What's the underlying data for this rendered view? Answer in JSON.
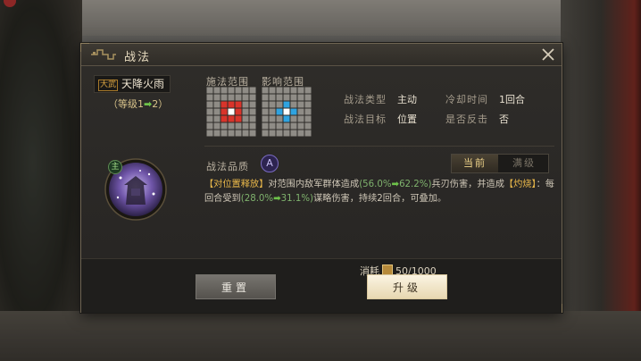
{
  "dialog": {
    "title": "战法",
    "close_label": "×"
  },
  "skill": {
    "badge": "大武",
    "name": "天降火雨",
    "level_prefix": "（等级1",
    "level_arrow": "➡",
    "level_suffix": "2）",
    "main_badge": "主"
  },
  "ranges": {
    "cast_label": "施法范围",
    "effect_label": "影响范围"
  },
  "info": {
    "type_label": "战法类型",
    "type_value": "主动",
    "cooldown_label": "冷却时间",
    "cooldown_value": "1回合",
    "target_label": "战法目标",
    "target_value": "位置",
    "counter_label": "是否反击",
    "counter_value": "否"
  },
  "quality": {
    "label": "战法品质",
    "grade": "A"
  },
  "toggle": {
    "current": "当前",
    "max": "满级"
  },
  "description": {
    "kw1": "【对位置释放】",
    "t1": "对范围内敌军群体造成",
    "n1a": "(56.0%",
    "arrow": "➡",
    "n1b": "62.2%)",
    "t2": "兵刃伤害，并造成",
    "kw2": "【灼烧】",
    "t3": "：每回合受到",
    "n2a": "(28.0%",
    "n2b": "31.1%)",
    "t4": "谋略伤害，持续2回合，可叠加。"
  },
  "cost": {
    "label": "消耗",
    "value": "50/1000"
  },
  "buttons": {
    "reset": "重置",
    "upgrade": "升级"
  },
  "colors": {
    "keyword": "#e8b74a",
    "number": "#7fb26d",
    "arrow": "#6ec24a",
    "cast_cell": "#d9342b",
    "effect_cell": "#2fa3e0"
  }
}
